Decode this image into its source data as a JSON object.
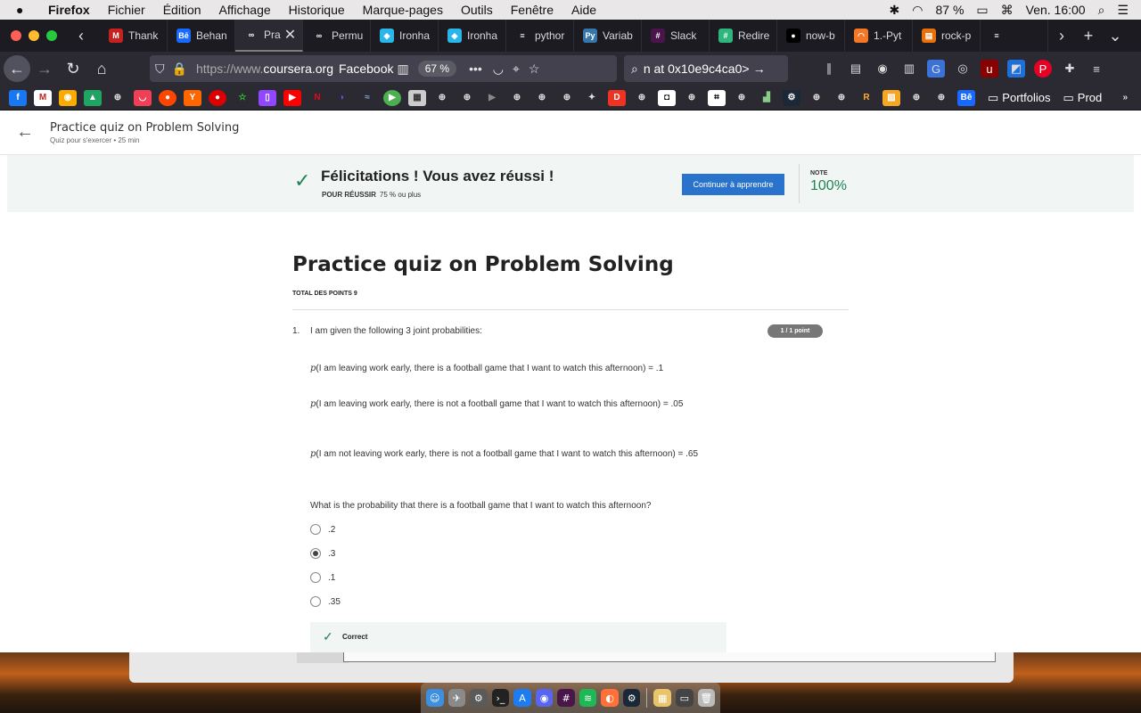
{
  "menubar": {
    "apple": "",
    "app": "Firefox",
    "items": [
      "Fichier",
      "Édition",
      "Affichage",
      "Historique",
      "Marque-pages",
      "Outils",
      "Fenêtre",
      "Aide"
    ],
    "battery": "87 %",
    "clock": "Ven. 16:00"
  },
  "tabs": [
    {
      "label": "Thank",
      "icon": "gmail-icon",
      "color": "#c5221f",
      "glyph": "M"
    },
    {
      "label": "Behan",
      "icon": "behance-icon",
      "color": "#1769ff",
      "glyph": "Bē"
    },
    {
      "label": "Pra",
      "icon": "coursera-icon",
      "color": "#2b2a33",
      "glyph": "∞",
      "active": true
    },
    {
      "label": "Permu",
      "icon": "coursera-icon",
      "color": "#1c1b22",
      "glyph": "∞"
    },
    {
      "label": "Ironha",
      "icon": "ironhack-icon",
      "color": "#2ab6e8",
      "glyph": "◆"
    },
    {
      "label": "Ironha",
      "icon": "ironhack-icon",
      "color": "#2ab6e8",
      "glyph": "◆"
    },
    {
      "label": "pythor",
      "icon": "stackoverflow-icon",
      "color": "#1c1b22",
      "glyph": "≡"
    },
    {
      "label": "Variab",
      "icon": "python-icon",
      "color": "#3776ab",
      "glyph": "Py"
    },
    {
      "label": "Slack",
      "icon": "slack-icon",
      "color": "#4a154b",
      "glyph": "#"
    },
    {
      "label": "Redire",
      "icon": "slack-icon",
      "color": "#2eb67d",
      "glyph": "#"
    },
    {
      "label": "now-b",
      "icon": "github-icon",
      "color": "#000000",
      "glyph": "●"
    },
    {
      "label": "1.-Pyt",
      "icon": "jupyter-icon",
      "color": "#f37726",
      "glyph": "◠"
    },
    {
      "label": "rock-p",
      "icon": "colab-icon",
      "color": "#e8710a",
      "glyph": "▤"
    },
    {
      "label": "",
      "icon": "stackoverflow-icon",
      "color": "#1c1b22",
      "glyph": "≡"
    }
  ],
  "navbar": {
    "url_prefix": "https://www.",
    "url_domain": "coursera.org",
    "bookmark_hint": "Facebook",
    "zoom": "67 %",
    "search": "n at 0x10e9c4ca0>"
  },
  "bookmarks": {
    "folders": [
      "Portfolios",
      "Prod"
    ]
  },
  "page": {
    "header_title": "Practice quiz on Problem Solving",
    "header_sub": "Quiz pour s'exercer • 25  min",
    "banner_title": "Félicitations ! Vous avez réussi !",
    "pass_label": "POUR RÉUSSIR",
    "pass_value": "75 % ou plus",
    "continue_label": "Continuer à apprendre",
    "grade_label": "NOTE",
    "grade_value": "100%",
    "quiz_title": "Practice quiz on Problem Solving",
    "total_points": "TOTAL DES POINTS 9",
    "question": {
      "number": "1.",
      "intro": "I am given the following 3 joint probabilities:",
      "badge": "1 / 1 point",
      "lines": [
        "(I am leaving work early, there is a football game that I want to watch this afternoon) = .1",
        "(I am leaving work early, there is not a football game that I want to watch this afternoon) = .05",
        "(I am not leaving work early, there is not a football game that I want to watch this afternoon) = .65"
      ],
      "p_symbol": "p",
      "prompt": "What is the probability that there is a football game that I want to watch this afternoon?",
      "options": [
        ".2",
        ".3",
        ".1",
        ".35"
      ],
      "selected_index": 1,
      "feedback": "Correct"
    }
  }
}
